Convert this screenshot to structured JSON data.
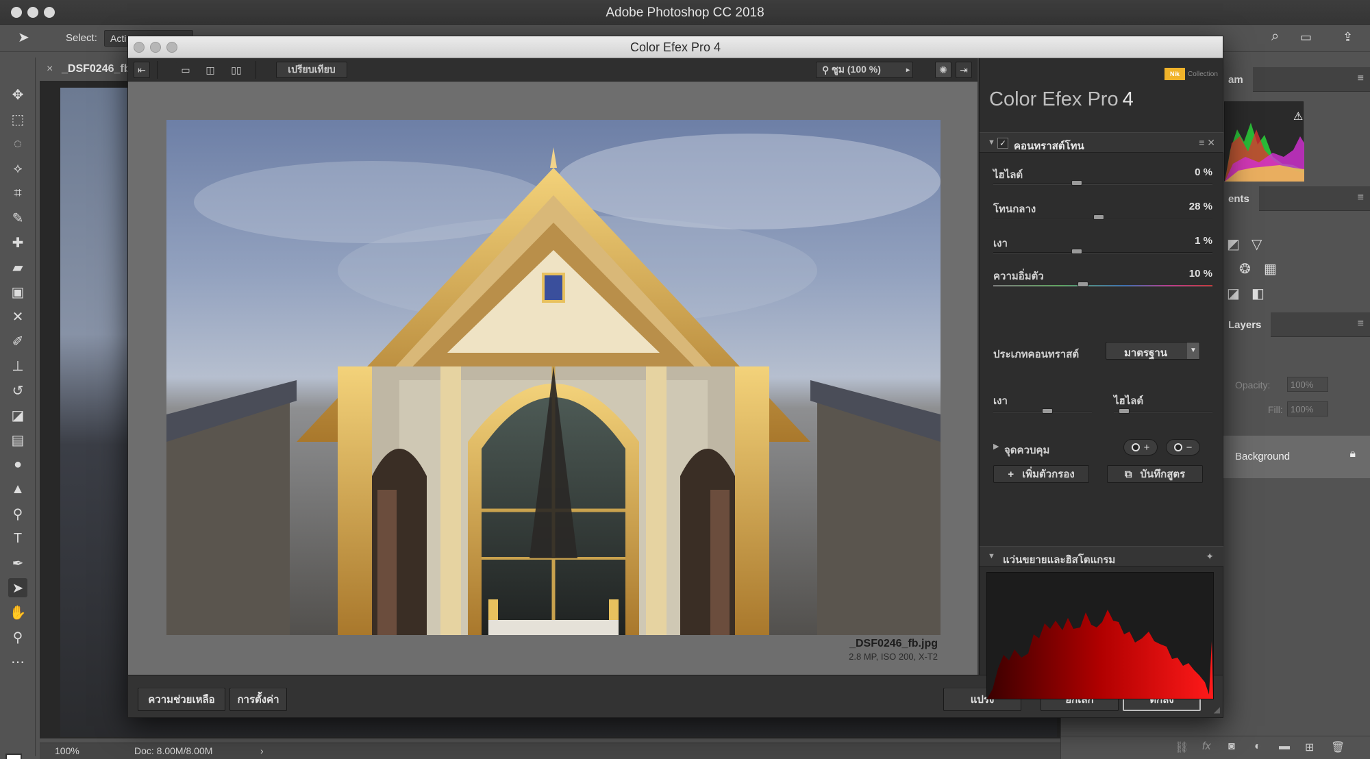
{
  "photoshop": {
    "app_title": "Adobe Photoshop CC 2018",
    "options_bar": {
      "select_label": "Select:",
      "select_value": "Acti"
    },
    "document_tab": {
      "close": "×",
      "name": "_DSF0246_fb"
    },
    "status": {
      "zoom": "100%",
      "doc": "Doc: 8.00M/8.00M"
    },
    "panels": {
      "histogram_tab": "am",
      "adjustments_tab": "ents",
      "layers_tab": "Layers",
      "opacity_label": "Opacity:",
      "opacity_value": "100%",
      "fill_label": "Fill:",
      "fill_value": "100%",
      "background_layer": "Background"
    }
  },
  "dialog": {
    "title": "Color Efex Pro 4",
    "toolbar": {
      "compare": "เปรียบเทียบ",
      "zoom": "ซูม (100 %)"
    },
    "brand": {
      "name": "Color Efex Pro",
      "version": "4",
      "nik": "Nik",
      "collection": "Collection"
    },
    "filter": {
      "name": "คอนทราสต์โทน",
      "sliders": [
        {
          "label": "ไฮไลต์",
          "value": "0 %",
          "pos": 0.38
        },
        {
          "label": "โทนกลาง",
          "value": "28 %",
          "pos": 0.48
        },
        {
          "label": "เงา",
          "value": "1 %",
          "pos": 0.38
        },
        {
          "label": "ความอิ่มตัว",
          "value": "10 %",
          "pos": 0.41
        }
      ],
      "contrast_type_label": "ประเภทคอนทราสต์",
      "contrast_type_value": "มาตรฐาน",
      "shadow_label": "เงา",
      "highlight_label": "ไฮไลต์",
      "shadow_pos": 0.55,
      "highlight_pos": 0.05,
      "control_points_label": "จุดควบคุม",
      "add_filter": "เพิ่มตัวกรอง",
      "save_recipe": "บันทึกสูตร"
    },
    "loupe_title": "แว่นขยายและฮิสโตแกรม",
    "file_name": "_DSF0246_fb.jpg",
    "file_meta": "2.8 MP, ISO 200, X-T2",
    "buttons": {
      "help": "ความช่วยเหลือ",
      "settings": "การตั้งค่า",
      "brush": "แปรง",
      "cancel": "ยกเลิก",
      "ok": "ตกลง"
    }
  }
}
